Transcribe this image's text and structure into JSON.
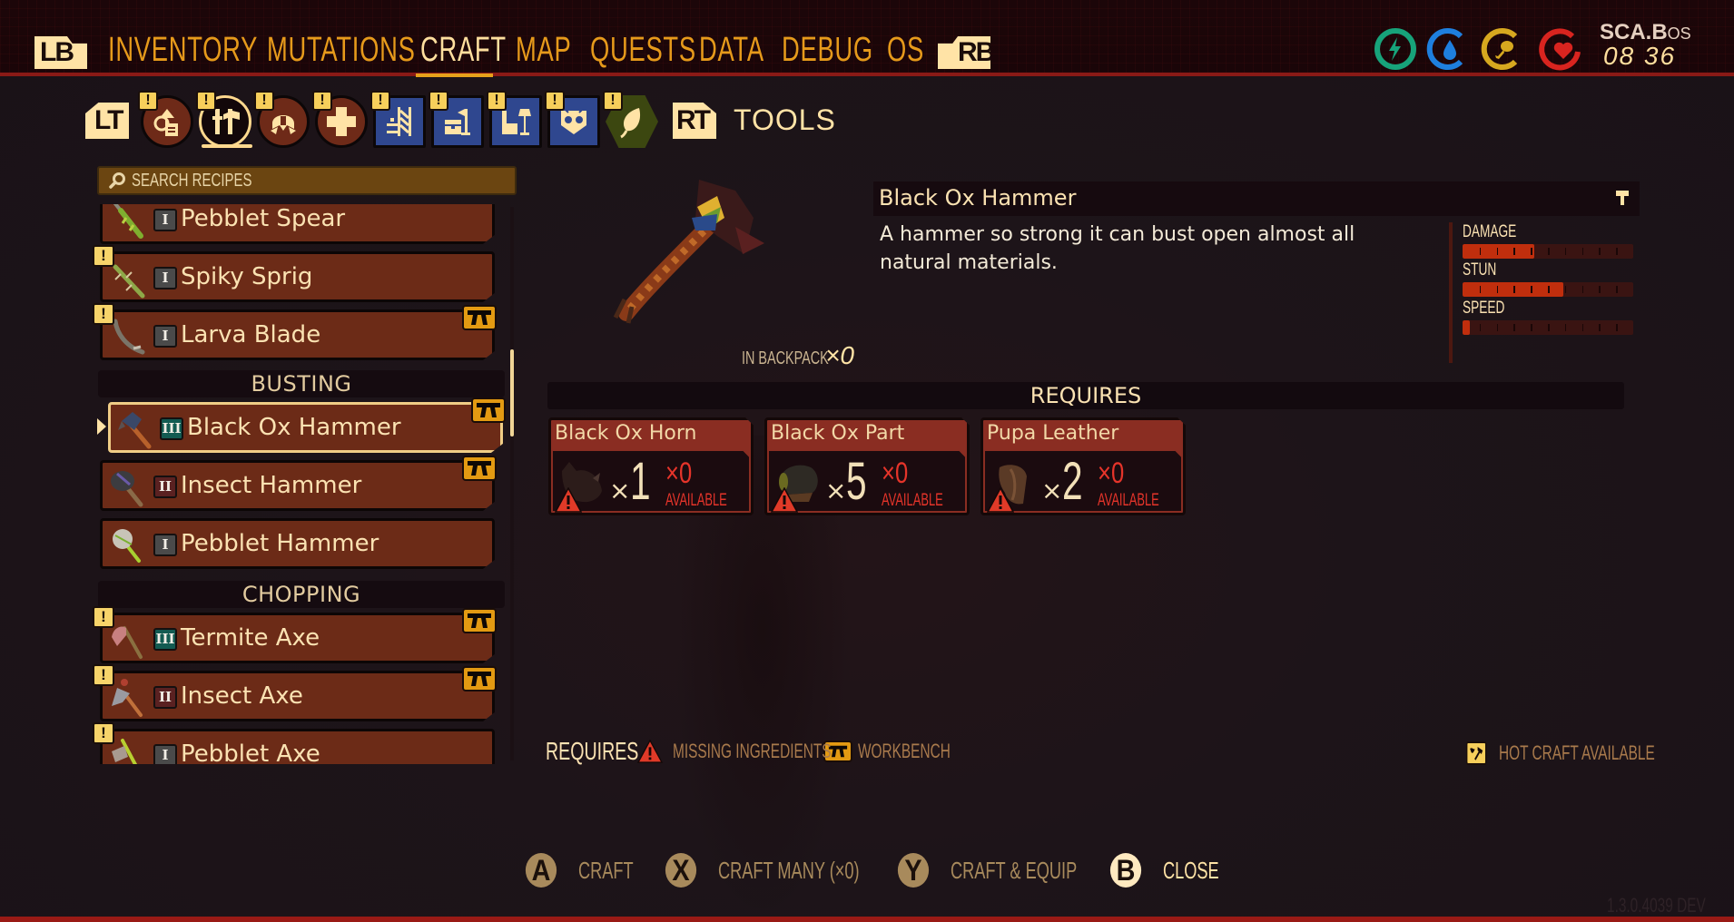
{
  "topbar": {
    "left_bumper": "LB",
    "right_bumper": "RB",
    "tabs": [
      {
        "label": "INVENTORY",
        "active": false
      },
      {
        "label": "MUTATIONS",
        "active": false
      },
      {
        "label": "CRAFT",
        "active": true
      },
      {
        "label": "MAP",
        "active": false
      },
      {
        "label": "QUESTS",
        "active": false
      },
      {
        "label": "DATA",
        "active": false
      },
      {
        "label": "DEBUG",
        "active": false
      },
      {
        "label": "OS",
        "active": false
      }
    ],
    "vitals": [
      {
        "name": "energy",
        "icon": "lightning-icon",
        "color": "#17a37a",
        "fill": 1.0
      },
      {
        "name": "water",
        "icon": "water-drop-icon",
        "color": "#1e7fde",
        "fill": 0.75
      },
      {
        "name": "food",
        "icon": "drumstick-icon",
        "color": "#d7a81f",
        "fill": 0.75
      },
      {
        "name": "health",
        "icon": "heart-icon",
        "color": "#d8241f",
        "fill": 0.8
      }
    ],
    "clock_brand": "SCA.B",
    "clock_suffix": "OS",
    "clock_time": "08 36"
  },
  "categories": {
    "left_trigger": "LT",
    "right_trigger": "RT",
    "selected_title": "TOOLS",
    "items": [
      {
        "name": "resources",
        "icon": "resources-icon",
        "shape": "round",
        "new": true
      },
      {
        "name": "tools",
        "icon": "tools-icon",
        "shape": "round",
        "new": true,
        "selected": true
      },
      {
        "name": "armor",
        "icon": "helmet-icon",
        "shape": "round",
        "new": true
      },
      {
        "name": "healing",
        "icon": "cross-icon",
        "shape": "round",
        "new": true
      },
      {
        "name": "building",
        "icon": "scaffold-icon",
        "shape": "square",
        "new": true
      },
      {
        "name": "storage",
        "icon": "chest-flag-icon",
        "shape": "square",
        "new": true
      },
      {
        "name": "furniture",
        "icon": "chair-lamp-icon",
        "shape": "square",
        "new": true
      },
      {
        "name": "decor",
        "icon": "shield-creature-icon",
        "shape": "square",
        "new": true
      },
      {
        "name": "nature",
        "icon": "leaf-icon",
        "shape": "hex",
        "new": true
      }
    ]
  },
  "search": {
    "placeholder": "SEARCH RECIPES"
  },
  "recipes": {
    "rows": [
      {
        "type": "item",
        "name": "Pebblet Spear",
        "tier": "I",
        "new": false,
        "workbench": false
      },
      {
        "type": "item",
        "name": "Spiky Sprig",
        "tier": "I",
        "new": true,
        "workbench": false
      },
      {
        "type": "item",
        "name": "Larva Blade",
        "tier": "I",
        "new": true,
        "workbench": true
      },
      {
        "type": "section",
        "name": "BUSTING"
      },
      {
        "type": "item",
        "name": "Black Ox Hammer",
        "tier": "III",
        "new": false,
        "workbench": true,
        "selected": true
      },
      {
        "type": "item",
        "name": "Insect Hammer",
        "tier": "II",
        "new": false,
        "workbench": true
      },
      {
        "type": "item",
        "name": "Pebblet Hammer",
        "tier": "I",
        "new": false,
        "workbench": false
      },
      {
        "type": "section",
        "name": "CHOPPING"
      },
      {
        "type": "item",
        "name": "Termite Axe",
        "tier": "III",
        "new": true,
        "workbench": true
      },
      {
        "type": "item",
        "name": "Insect Axe",
        "tier": "II",
        "new": true,
        "workbench": true
      },
      {
        "type": "item",
        "name": "Pebblet Axe",
        "tier": "I",
        "new": true,
        "workbench": false
      }
    ]
  },
  "detail": {
    "title": "Black Ox Hammer",
    "description": "A hammer so strong it can bust open almost all natural materials.",
    "in_backpack_label": "IN BACKPACK",
    "in_backpack_count": "×0",
    "stats": [
      {
        "label": "DAMAGE",
        "value": 0.42
      },
      {
        "label": "STUN",
        "value": 0.59
      },
      {
        "label": "SPEED",
        "value": 0.04
      }
    ],
    "requires_header": "REQUIRES",
    "ingredients": [
      {
        "name": "Black Ox Horn",
        "required": "1",
        "have": "×0",
        "available_label": "AVAILABLE",
        "missing": true
      },
      {
        "name": "Black Ox Part",
        "required": "5",
        "have": "×0",
        "available_label": "AVAILABLE",
        "missing": true
      },
      {
        "name": "Pupa Leather",
        "required": "2",
        "have": "×0",
        "available_label": "AVAILABLE",
        "missing": true
      }
    ]
  },
  "legend": {
    "requires_label": "REQUIRES",
    "missing_label": "MISSING INGREDIENTS",
    "workbench_label": "WORKBENCH",
    "hotcraft_label": "HOT CRAFT AVAILABLE"
  },
  "prompts": [
    {
      "button": "A",
      "label": "CRAFT"
    },
    {
      "button": "X",
      "label": "CRAFT MANY (×0)"
    },
    {
      "button": "Y",
      "label": "CRAFT & EQUIP"
    },
    {
      "button": "B",
      "label": "CLOSE"
    }
  ],
  "version": "1.3.0.4039 DEV",
  "colors": {
    "accent_gold": "#e69a1b",
    "cream": "#ffe3a6",
    "recipe_bg": "#6c2b17",
    "missing_red": "#e5342a",
    "stat_fill": "#c02e0d"
  }
}
